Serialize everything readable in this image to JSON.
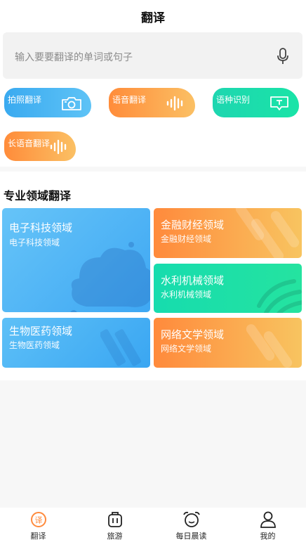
{
  "header": {
    "title": "翻译"
  },
  "search": {
    "placeholder": "输入要要翻译的单词或句子",
    "icon": "microphone-icon"
  },
  "quick_actions": [
    {
      "label": "拍照翻译",
      "icon": "camera-icon"
    },
    {
      "label": "语音翻译",
      "icon": "sound-wave-icon"
    },
    {
      "label": "语种识别",
      "icon": "text-bubble-icon"
    },
    {
      "label": "长语音翻译",
      "icon": "sound-wave-icon"
    }
  ],
  "domains": {
    "title": "专业领域翻译",
    "cards": [
      {
        "title": "电子科技领域",
        "subtitle": "电子科技领域"
      },
      {
        "title": "金融财经领域",
        "subtitle": "金融财经领域"
      },
      {
        "title": "水利机械领域",
        "subtitle": "水利机械领域"
      },
      {
        "title": "生物医药领域",
        "subtitle": "生物医药领域"
      },
      {
        "title": "网络文学领域",
        "subtitle": "网络文学领域"
      }
    ]
  },
  "tabbar": {
    "items": [
      {
        "label": "翻译",
        "icon": "translate-icon",
        "active": true,
        "glyph": "译"
      },
      {
        "label": "旅游",
        "icon": "luggage-icon",
        "active": false
      },
      {
        "label": "每日晨读",
        "icon": "alarm-clock-icon",
        "active": false
      },
      {
        "label": "我的",
        "icon": "user-icon",
        "active": false
      }
    ]
  },
  "colors": {
    "blue": "#3ea7f3",
    "orange": "#ff8a3c",
    "yellow": "#f8c460",
    "green": "#16dcae",
    "active_tab": "#ff8a3c"
  }
}
